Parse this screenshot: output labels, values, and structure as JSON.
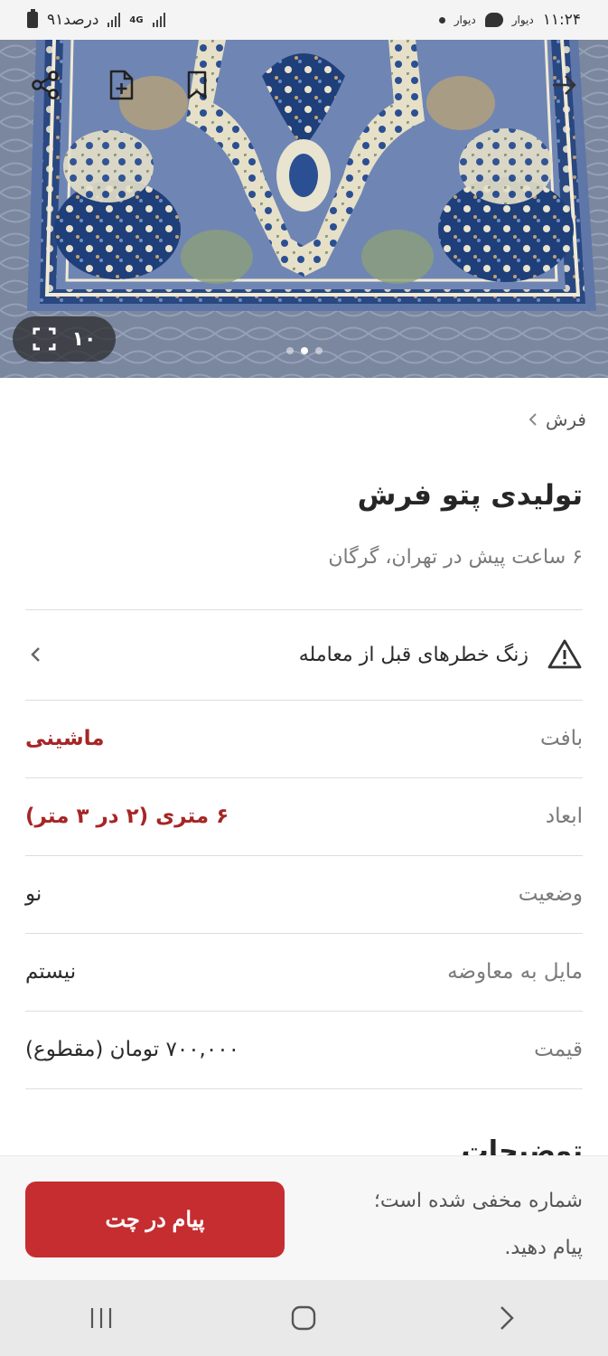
{
  "status_bar": {
    "battery": "۹۱درصد",
    "network": "4G",
    "time": "۱۱:۲۴",
    "notif_app_1": "دیوار",
    "notif_app_2": "دیوار"
  },
  "hero": {
    "photo_count": "۱۰",
    "icons": [
      "share-icon",
      "note-add-icon",
      "bookmark-icon",
      "back-arrow-icon",
      "fullscreen-icon"
    ]
  },
  "breadcrumb": {
    "label": "فرش"
  },
  "title": "تولیدی پتو فرش",
  "subtitle": "۶ ساعت پیش در تهران، گرگان",
  "warning": {
    "label": "زنگ خطرهای قبل از معامله"
  },
  "specs": [
    {
      "label": "بافت",
      "value": "ماشینی"
    },
    {
      "label": "ابعاد",
      "value": "۶ متری (۲ در ۳ متر)"
    },
    {
      "label": "وضعیت",
      "value": "نو"
    },
    {
      "label": "مایل به معاوضه",
      "value": "نیستم"
    },
    {
      "label": "قیمت",
      "value": "۷۰۰,۰۰۰ تومان (مقطوع)"
    }
  ],
  "description_heading": "توضیحات",
  "bottom_bar": {
    "note_line1": "شماره مخفی شده است؛",
    "note_line2": "پیام دهید.",
    "chat_button": "پیام در چت"
  },
  "colors": {
    "accent": "#c62d30",
    "highlight_value": "#a62626",
    "muted_text": "#7a7a7a"
  }
}
